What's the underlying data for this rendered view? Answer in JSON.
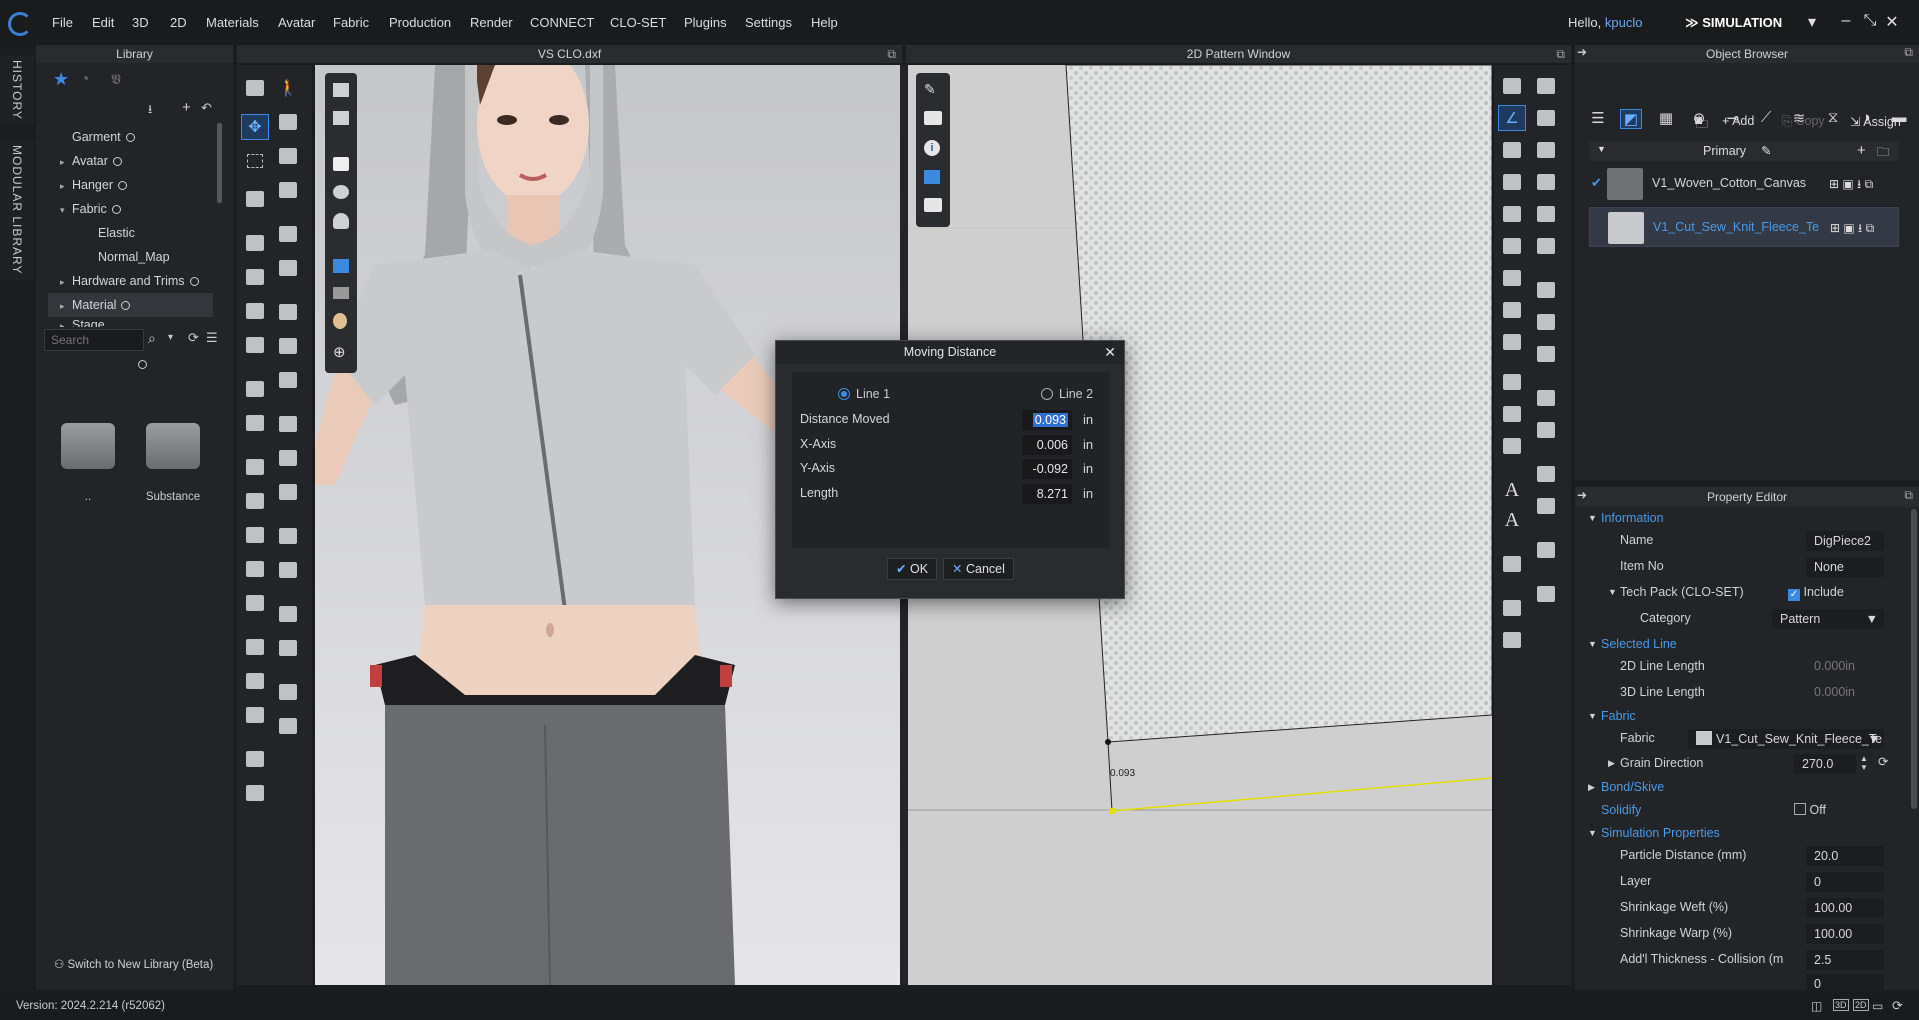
{
  "menu": [
    "File",
    "Edit",
    "3D",
    "2D",
    "Materials",
    "Avatar",
    "Fabric",
    "Production",
    "Render",
    "CONNECT",
    "CLO-SET",
    "Plugins",
    "Settings",
    "Help"
  ],
  "header": {
    "hello": "Hello,",
    "user": "kpuclo",
    "mode": "SIMULATION",
    "mode_dropdown": "▾",
    "minimize": "–",
    "restore": "⤡",
    "close": "✕"
  },
  "side_tabs": {
    "history": "HISTORY",
    "modular": "MODULAR LIBRARY"
  },
  "library": {
    "title": "Library",
    "tree": [
      {
        "label": "Garment",
        "level": 0,
        "expand": ""
      },
      {
        "label": "Avatar",
        "level": 0,
        "expand": "▸"
      },
      {
        "label": "Hanger",
        "level": 0,
        "expand": "▸"
      },
      {
        "label": "Fabric",
        "level": 0,
        "expand": "▾"
      },
      {
        "label": "Elastic",
        "level": 1,
        "expand": ""
      },
      {
        "label": "Normal_Map",
        "level": 1,
        "expand": ""
      },
      {
        "label": "Hardware and Trims",
        "level": 0,
        "expand": "▸"
      },
      {
        "label": "Material",
        "level": 0,
        "expand": "▸"
      },
      {
        "label": "Stage",
        "level": 0,
        "expand": "▸"
      }
    ],
    "search_placeholder": "Search",
    "folders": [
      "..",
      "Substance"
    ],
    "switch_label": "Switch to New Library (Beta)"
  },
  "viewport3d": {
    "title": "VS CLO.dxf"
  },
  "view2d": {
    "title": "2D Pattern Window",
    "measure": "0.093"
  },
  "dialog": {
    "title": "Moving Distance",
    "line1": "Line 1",
    "line2": "Line 2",
    "rows": [
      {
        "label": "Distance Moved",
        "value": "0.093",
        "unit": "in"
      },
      {
        "label": "X-Axis",
        "value": "0.006",
        "unit": "in"
      },
      {
        "label": "Y-Axis",
        "value": "-0.092",
        "unit": "in"
      },
      {
        "label": "Length",
        "value": "8.271",
        "unit": "in"
      }
    ],
    "ok": "OK",
    "cancel": "Cancel"
  },
  "object_browser": {
    "title": "Object Browser",
    "add": "Add",
    "copy": "Copy",
    "assign": "Assign",
    "primary": "Primary",
    "materials": [
      {
        "name": "V1_Woven_Cotton_Canvas",
        "color": "#6f7174",
        "selected": false
      },
      {
        "name": "V1_Cut_Sew_Knit_Fleece_Te",
        "color": "#c7c9cc",
        "selected": true
      }
    ]
  },
  "property_editor": {
    "title": "Property Editor",
    "information": "Information",
    "name_label": "Name",
    "name_value": "DigPiece2",
    "item_label": "Item No",
    "item_value": "None",
    "techpack_label": "Tech Pack (CLO-SET)",
    "include": "Include",
    "category_label": "Category",
    "category_value": "Pattern",
    "selected_line": "Selected Line",
    "len2d_label": "2D Line Length",
    "len2d_value": "0.000in",
    "len3d_label": "3D Line Length",
    "len3d_value": "0.000in",
    "fabric_sec": "Fabric",
    "fabric_label": "Fabric",
    "fabric_value": "V1_Cut_Sew_Knit_Fleece_Te",
    "grain_label": "Grain Direction",
    "grain_value": "270.0",
    "bond": "Bond/Skive",
    "solidify": "Solidify",
    "solidify_value": "Off",
    "sim_props": "Simulation Properties",
    "rows": [
      {
        "label": "Particle Distance (mm)",
        "value": "20.0"
      },
      {
        "label": "Layer",
        "value": "0"
      },
      {
        "label": "Shrinkage Weft (%)",
        "value": "100.00"
      },
      {
        "label": "Shrinkage Warp (%)",
        "value": "100.00"
      },
      {
        "label": "Add'l Thickness - Collision (m",
        "value": "2.5"
      }
    ],
    "last_value": "0"
  },
  "footer": {
    "version": "Version: 2024.2.214 (r52062)",
    "btn3d": "3D",
    "btn2d": "2D"
  }
}
